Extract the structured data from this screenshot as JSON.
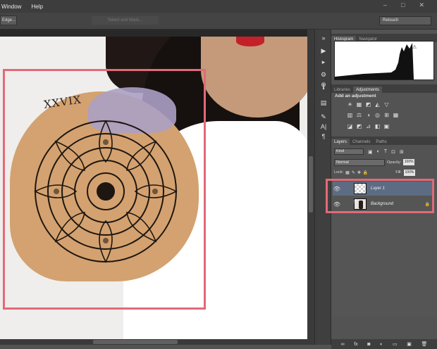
{
  "menu": {
    "items": [
      "Window",
      "Help"
    ]
  },
  "options_bar": {
    "left_button": "Edge...",
    "center_ghost": "Select and Mask...",
    "workspace": "Retouch"
  },
  "canvas": {
    "tattoo_text": "XXVIX"
  },
  "tools": [
    "▶",
    "▸",
    "⚙",
    "⊕",
    "ℹ",
    "▤",
    "✎",
    "A|",
    "¶"
  ],
  "panel_top": {
    "tabs": [
      "Histogram",
      "Navigator"
    ],
    "active": "Histogram"
  },
  "panel_mid": {
    "tabs": [
      "Libraries",
      "Adjustments"
    ],
    "active": "Adjustments",
    "add_label": "Add an adjustment"
  },
  "adjustment_icons_row1": [
    "☀",
    "▦",
    "◩",
    "◭",
    "▽"
  ],
  "adjustment_icons_row2": [
    "▥",
    "⚖",
    "◑",
    "◎",
    "⊞",
    "▦"
  ],
  "adjustment_icons_row3": [
    "◪",
    "◩",
    "⊿",
    "◧",
    "▣"
  ],
  "layers_panel": {
    "tabs": [
      "Layers",
      "Channels",
      "Paths"
    ],
    "active": "Layers",
    "kind": "Kind",
    "blend_mode": "Normal",
    "opacity_label": "Opacity:",
    "opacity_value": "100%",
    "lock_label": "Lock:",
    "fill_label": "Fill:",
    "fill_value": "100%",
    "layers": [
      {
        "name": "Layer 1",
        "selected": true
      },
      {
        "name": "Background",
        "selected": false,
        "locked": true
      }
    ]
  },
  "footer_icons": [
    "∞",
    "fx",
    "◙",
    "◐",
    "▭",
    "▣",
    "🗑"
  ],
  "colors": {
    "highlight": "#e26a78",
    "selected_layer": "#5d6c82"
  }
}
